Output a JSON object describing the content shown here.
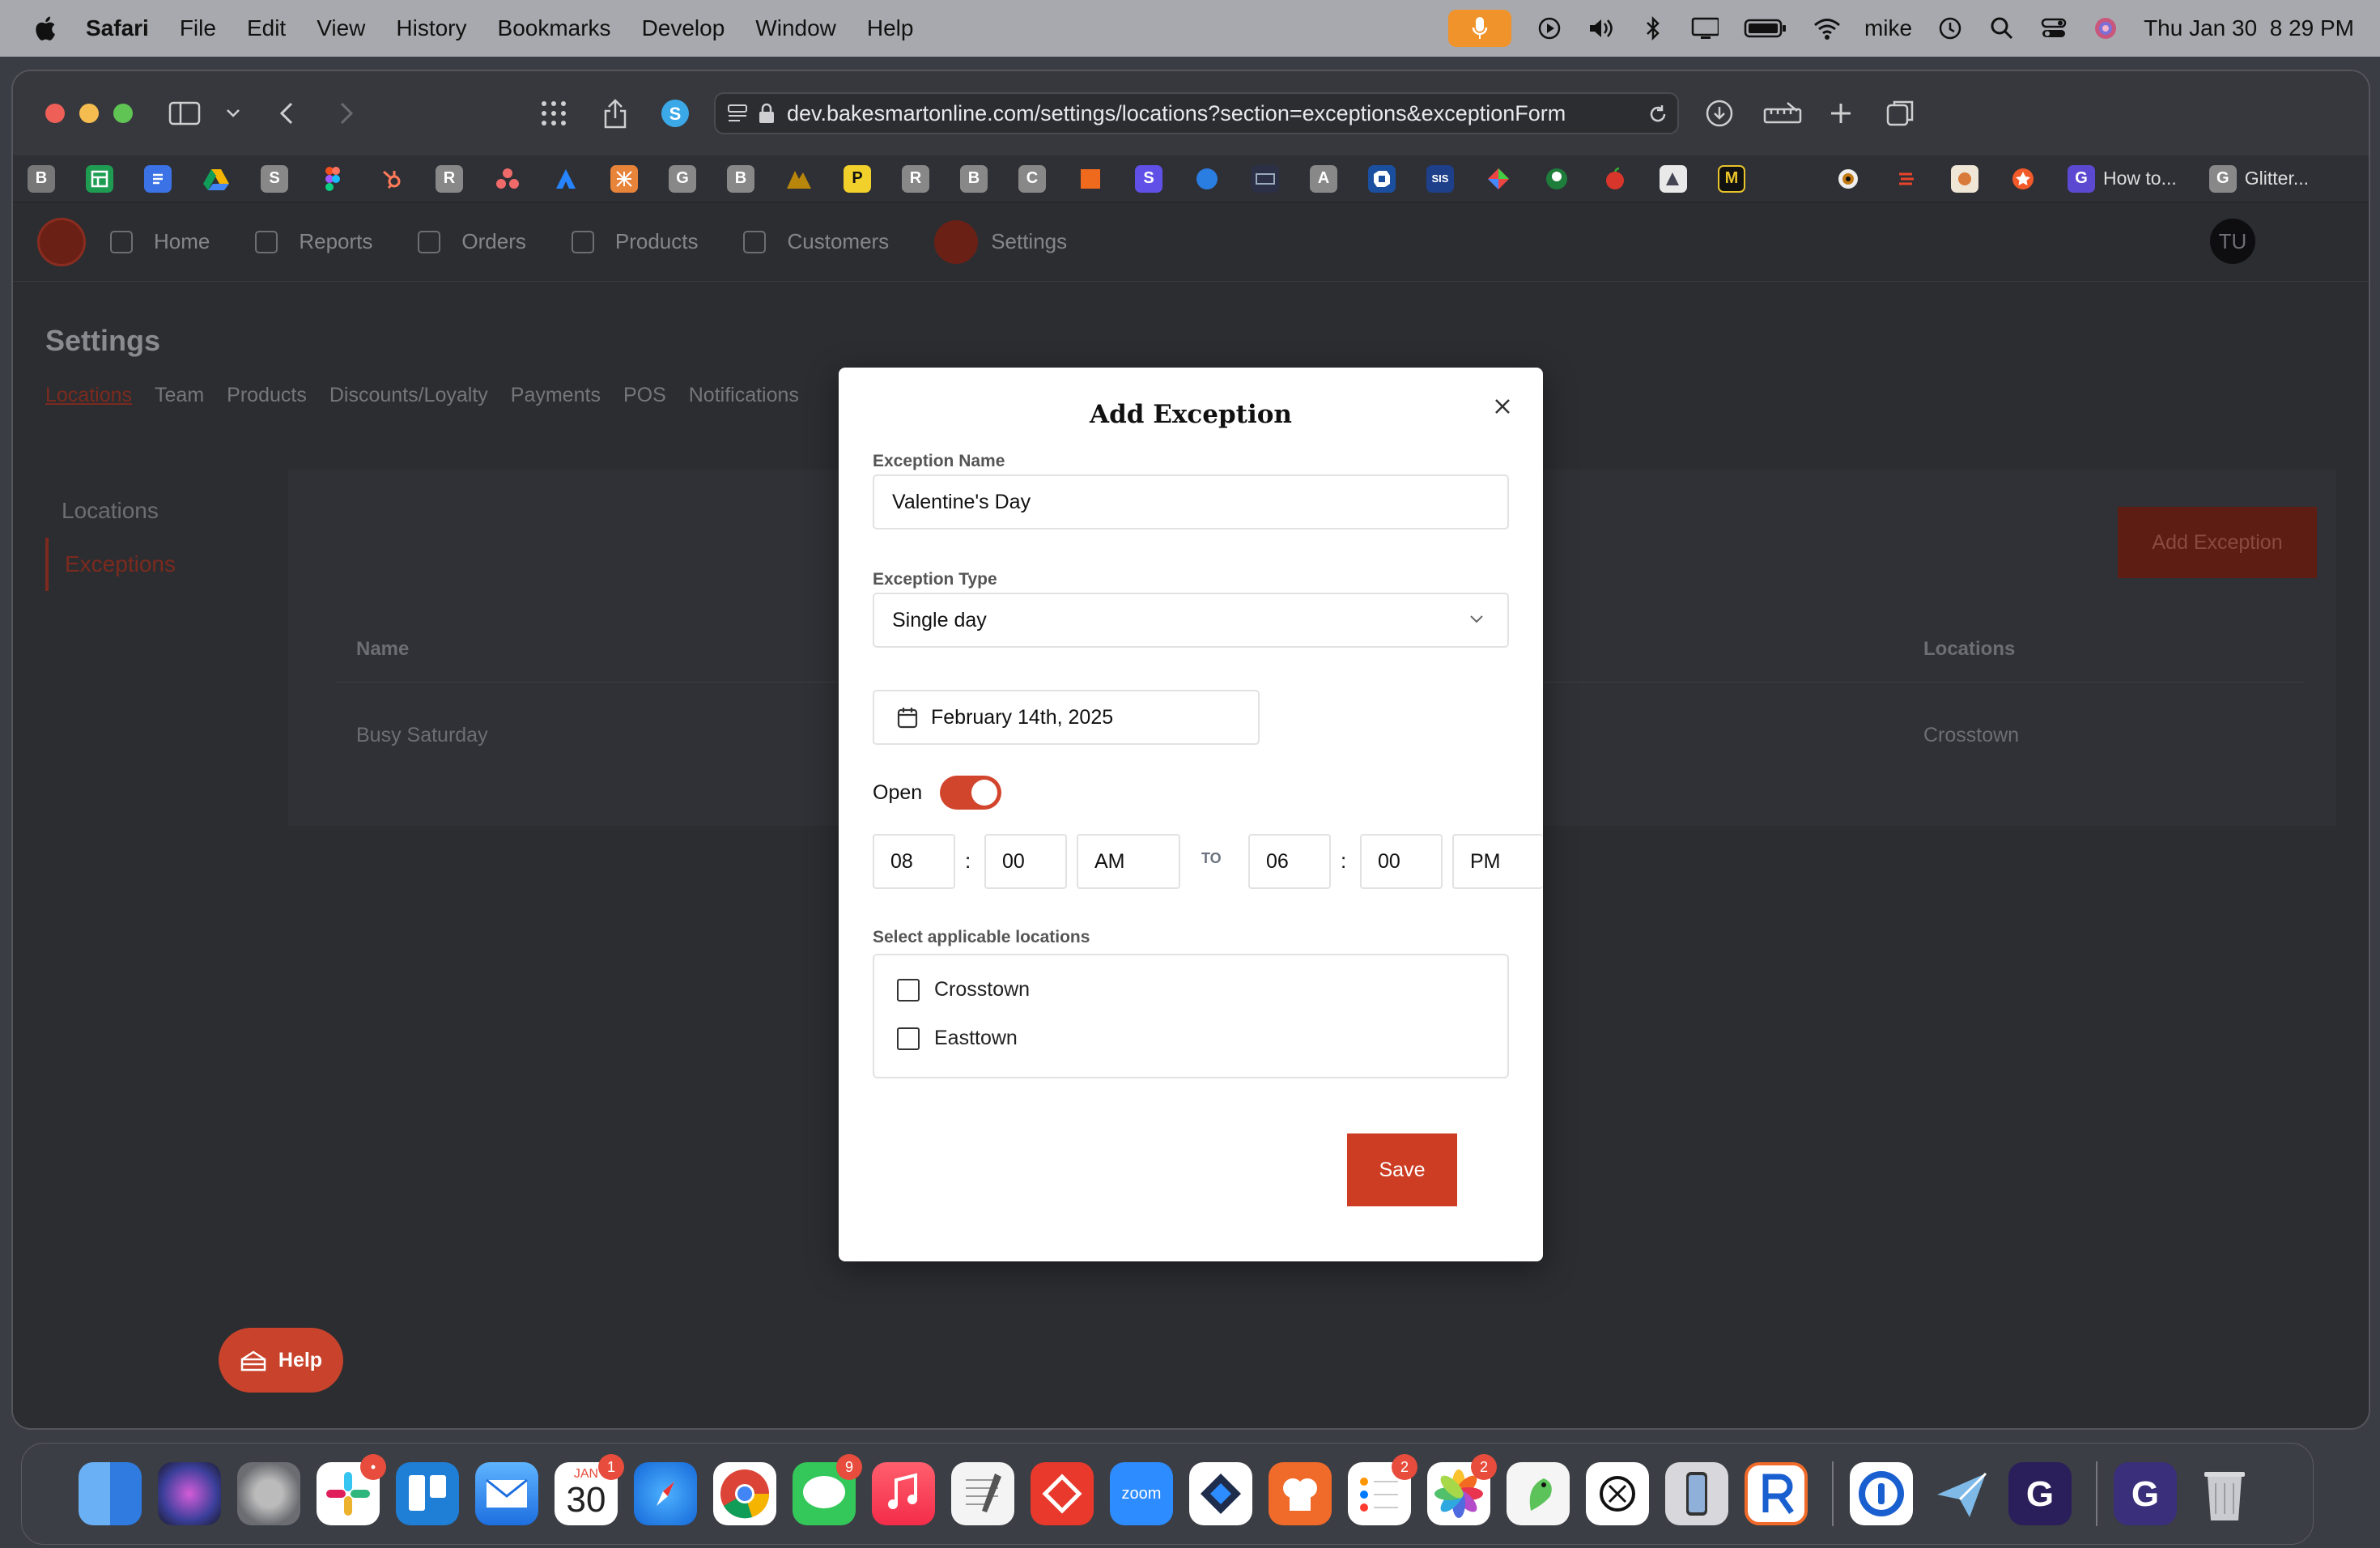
{
  "menubar": {
    "app_name": "Safari",
    "items": [
      "File",
      "Edit",
      "View",
      "History",
      "Bookmarks",
      "Develop",
      "Window",
      "Help"
    ],
    "user": "mike",
    "datetime": "Thu Jan 30  8 29 PM"
  },
  "browser": {
    "url": "dev.bakesmartonline.com/settings/locations?section=exceptions&exceptionForm",
    "favorites": [
      "B",
      "",
      "",
      "",
      "S",
      "",
      "",
      "R",
      "",
      "",
      "",
      "G",
      "B",
      "",
      "P",
      "R",
      "B",
      "C",
      "",
      "S",
      "",
      "",
      "A",
      "",
      "SIS",
      "",
      "",
      "",
      "",
      "",
      "M"
    ],
    "tabs": [
      {
        "label": "How to..."
      },
      {
        "label": "Glitter..."
      }
    ]
  },
  "app": {
    "nav": [
      "Home",
      "Reports",
      "Orders",
      "Products",
      "Customers",
      "Settings"
    ],
    "active_nav": "Settings",
    "avatar_initials": "TU",
    "page_title": "Settings",
    "subtabs": [
      "Locations",
      "Team",
      "Products",
      "Discounts/Loyalty",
      "Payments",
      "POS",
      "Notifications"
    ],
    "sidenav": [
      "Locations",
      "Exceptions"
    ],
    "add_exception_label": "Add Exception",
    "table": {
      "headers": {
        "name": "Name",
        "locations": "Locations"
      },
      "rows": [
        {
          "name": "Busy Saturday",
          "locations": "Crosstown"
        }
      ]
    },
    "help_label": "Help"
  },
  "modal": {
    "title": "Add Exception",
    "name_label": "Exception Name",
    "name_value": "Valentine's Day",
    "type_label": "Exception Type",
    "type_value": "Single day",
    "date_value": "February 14th, 2025",
    "open_label": "Open",
    "open_on": true,
    "start_hour": "08",
    "start_min": "00",
    "start_ampm": "AM",
    "to_label": "TO",
    "end_hour": "06",
    "end_min": "00",
    "end_ampm": "PM",
    "colon": ":",
    "locations_label": "Select applicable locations",
    "locations": [
      "Crosstown",
      "Easttown"
    ],
    "save_label": "Save"
  },
  "dock": {
    "calendar_month": "JAN",
    "calendar_day": "30",
    "zoom_label": "zoom",
    "badges": {
      "slack": "•",
      "calendar": "1",
      "messages": "9",
      "reminders": "2",
      "photos": "2"
    }
  },
  "colors": {
    "brand": "#cc3d24",
    "toggle_on": "#d2452d",
    "mic_pill": "#f0932b"
  }
}
